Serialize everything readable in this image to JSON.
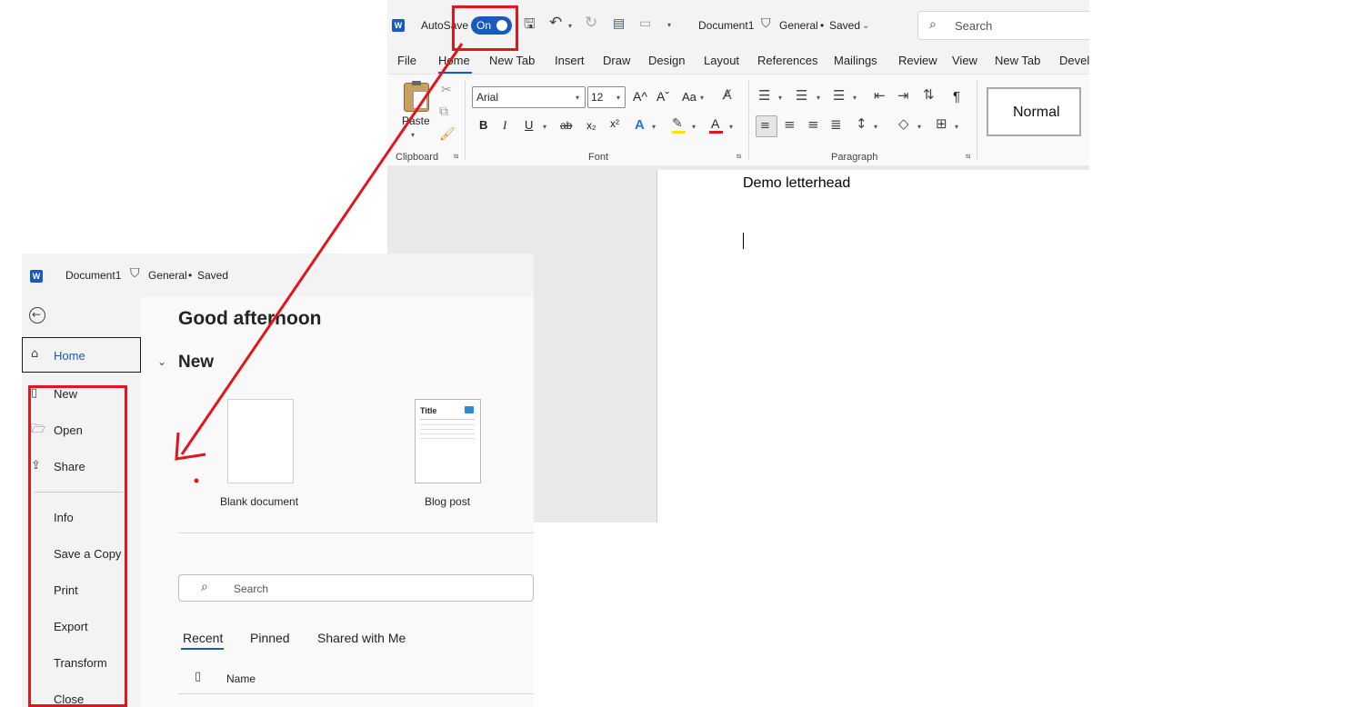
{
  "word": {
    "app_icon": "word-logo-icon",
    "autosave_label": "AutoSave",
    "autosave_state": "On",
    "doc_title": "Document1",
    "sensitivity": "General",
    "save_status": "Saved",
    "search_placeholder": "Search",
    "tabs": [
      "File",
      "Home",
      "New Tab",
      "Insert",
      "Draw",
      "Design",
      "Layout",
      "References",
      "Mailings",
      "Review",
      "View",
      "New Tab",
      "Devel"
    ],
    "ribbon": {
      "paste_label": "Paste",
      "clipboard_label": "Clipboard",
      "font_name": "Arial",
      "font_size": "12",
      "font_group_label": "Font",
      "paragraph_group_label": "Paragraph",
      "style_normal": "Normal",
      "bold": "B",
      "italic": "I",
      "underline": "U",
      "strike": "ab",
      "subscript": "x₂",
      "superscript": "x²",
      "font_color_letter": "A",
      "text_effects_letter": "A",
      "grow_font": "A^",
      "shrink_font": "Aˇ",
      "change_case": "Aa",
      "pilcrow": "¶"
    },
    "document_text": "Demo letterhead"
  },
  "backstage": {
    "title": "Document1",
    "sensitivity": "General",
    "save_status": "Saved",
    "greeting": "Good afternoon",
    "new_section": "New",
    "nav": {
      "home": "Home",
      "new": "New",
      "open": "Open",
      "share": "Share",
      "info": "Info",
      "save_copy": "Save a Copy",
      "print": "Print",
      "export": "Export",
      "transform": "Transform",
      "close": "Close"
    },
    "templates": [
      {
        "label": "Blank document"
      },
      {
        "label": "Blog post",
        "thumb_title": "Title"
      }
    ],
    "search_placeholder": "Search",
    "file_tabs": [
      "Recent",
      "Pinned",
      "Shared with Me"
    ],
    "list_header": "Name"
  },
  "colors": {
    "accent": "#185abd",
    "annotation_red": "#e3141b"
  }
}
